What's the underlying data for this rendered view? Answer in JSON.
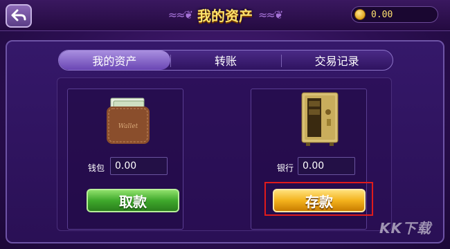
{
  "header": {
    "title": "我的资产",
    "coin_balance": "0.00",
    "title_ornament": "≈≈❦"
  },
  "tabs": [
    {
      "label": "我的资产",
      "active": true
    },
    {
      "label": "转账",
      "active": false
    },
    {
      "label": "交易记录",
      "active": false
    }
  ],
  "wallet": {
    "label": "钱包",
    "value": "0.00",
    "button_label": "取款"
  },
  "bank": {
    "label": "银行",
    "value": "0.00",
    "button_label": "存款"
  },
  "watermark": "KK下载",
  "colors": {
    "accent_gold": "#ffe26b",
    "highlight_red": "#e01b1b",
    "button_green": "#3fa82c",
    "button_gold": "#f3b21c"
  }
}
